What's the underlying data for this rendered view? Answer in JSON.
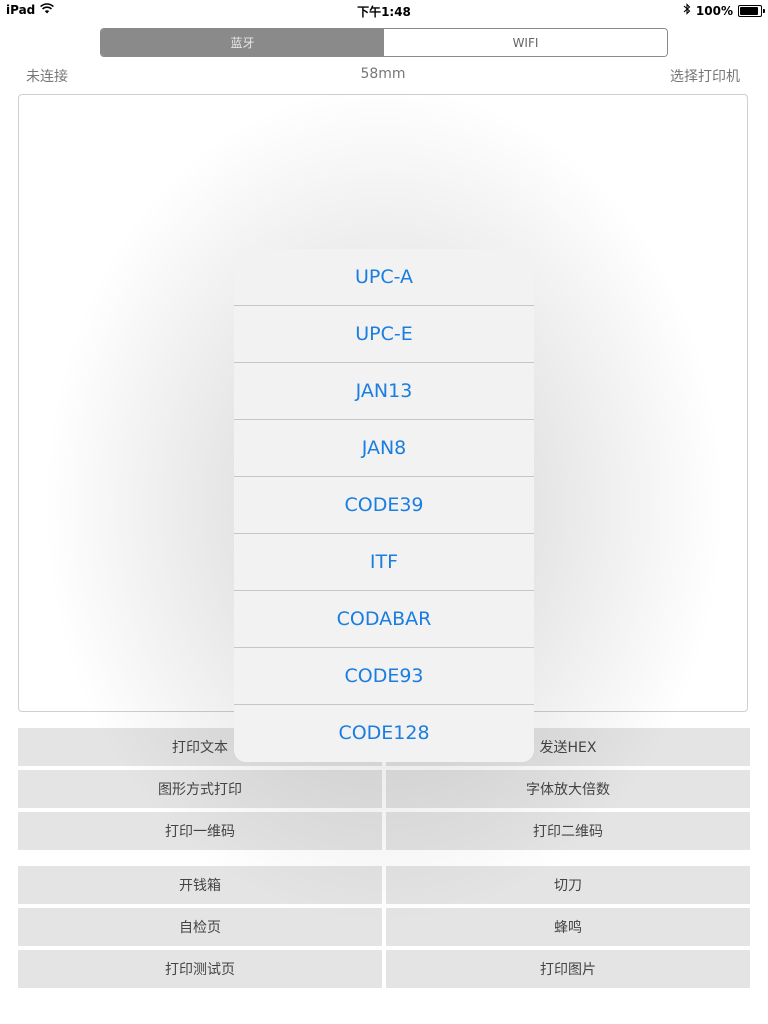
{
  "status_bar": {
    "device": "iPad",
    "time": "下午1:48",
    "battery": "100%",
    "battery_level": 1.0
  },
  "tabs": [
    {
      "label": "蓝牙",
      "selected": true
    },
    {
      "label": "WIFI",
      "selected": false
    }
  ],
  "info": {
    "connection": "未连接",
    "paper": "58mm",
    "select_printer": "选择打印机"
  },
  "text_area": {
    "value": ""
  },
  "buttons_group1": [
    {
      "label": "打印文本"
    },
    {
      "label": "发送HEX"
    },
    {
      "label": "图形方式打印"
    },
    {
      "label": "字体放大倍数"
    },
    {
      "label": "打印一维码"
    },
    {
      "label": "打印二维码"
    }
  ],
  "buttons_group2": [
    {
      "label": "开钱箱"
    },
    {
      "label": "切刀"
    },
    {
      "label": "自检页"
    },
    {
      "label": "蜂鸣"
    },
    {
      "label": "打印测试页"
    },
    {
      "label": "打印图片"
    }
  ],
  "barcode_menu": {
    "options": [
      "UPC-A",
      "UPC-E",
      "JAN13",
      "JAN8",
      "CODE39",
      "ITF",
      "CODABAR",
      "CODE93",
      "CODE128"
    ]
  },
  "colors": {
    "accent": "#1a7ee0",
    "segment_selected": "#8a8a8a",
    "button_bg": "#e4e4e4"
  }
}
